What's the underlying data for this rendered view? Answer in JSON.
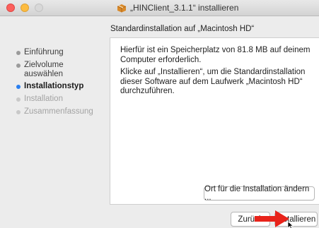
{
  "window": {
    "title": "„HINClient_3.1.1“ installieren"
  },
  "subheader": "Standardinstallation auf „Macintosh HD“",
  "sidebar": {
    "steps": [
      {
        "label": "Einführung",
        "state": "done"
      },
      {
        "label": "Zielvolume auswählen",
        "state": "done"
      },
      {
        "label": "Installationstyp",
        "state": "current"
      },
      {
        "label": "Installation",
        "state": "pending"
      },
      {
        "label": "Zusammenfassung",
        "state": "pending"
      }
    ]
  },
  "content": {
    "paragraph1": "Hierfür ist ein Speicherplatz von 81.8 MB auf deinem Computer erforderlich.",
    "paragraph2": "Klicke auf „Installieren“, um die Standardinstallation dieser Software auf dem Laufwerk „Macintosh HD“ durchzuführen."
  },
  "buttons": {
    "change_location": "Ort für die Installation ändern ...",
    "back": "Zurück",
    "install": "Installieren"
  },
  "colors": {
    "accent": "#2a7ff0",
    "arrow": "#e8231a"
  }
}
